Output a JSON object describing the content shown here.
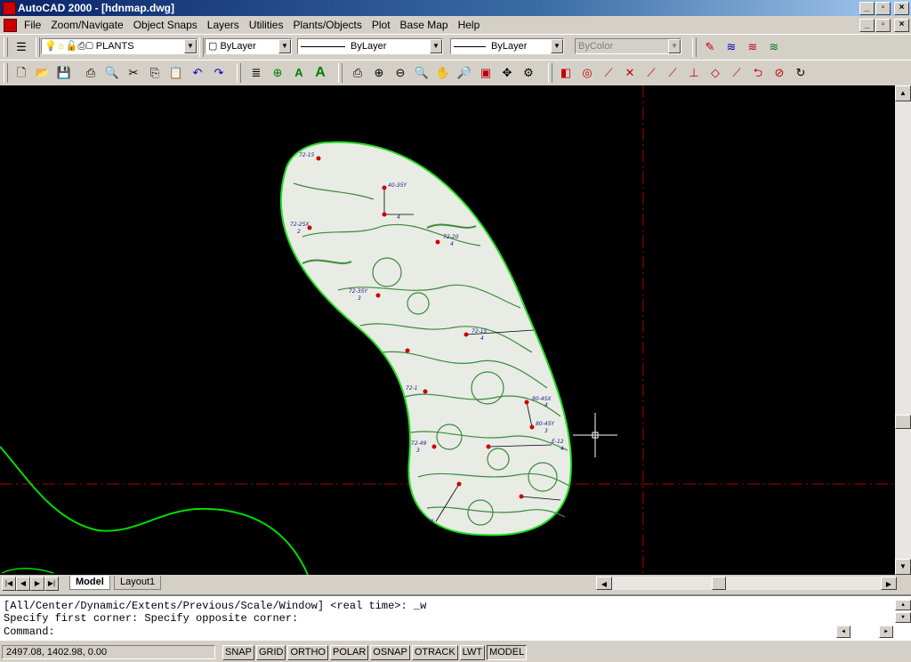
{
  "window": {
    "title": "AutoCAD 2000 - [hdnmap.dwg]",
    "buttons": [
      "_",
      "▫",
      "×"
    ]
  },
  "menubar": {
    "items": [
      "File",
      "Zoom/Navigate",
      "Object Snaps",
      "Layers",
      "Utilities",
      "Plants/Objects",
      "Plot",
      "Base Map",
      "Help"
    ]
  },
  "properties": {
    "layer": "PLANTS",
    "color": "ByLayer",
    "linetype": "ByLayer",
    "lineweight": "ByLayer",
    "plotstyle": "ByColor"
  },
  "map": {
    "labels": [
      "72-15",
      "40-35Y",
      "4",
      "72-25X",
      "2",
      "72-20",
      "4",
      "72-35Y",
      "3",
      "72-15",
      "4",
      "80-45X",
      "4",
      "80-45Y",
      "3",
      "72-49",
      "3",
      "72-1",
      "E-12",
      "4",
      "56"
    ],
    "colors": {
      "background": "#000000",
      "outline": "#00dd00",
      "points": "#cc0000",
      "crosshair": "#ffffff",
      "guide": "#aa0000"
    }
  },
  "tabs": {
    "model": "Model",
    "layout1": "Layout1"
  },
  "command": {
    "line1": "[All/Center/Dynamic/Extents/Previous/Scale/Window] <real time>: _w",
    "line2": "Specify first corner: Specify opposite corner:",
    "prompt": "Command:"
  },
  "status": {
    "coords": "2497.08, 1402.98, 0.00",
    "buttons": [
      "SNAP",
      "GRID",
      "ORTHO",
      "POLAR",
      "OSNAP",
      "OTRACK",
      "LWT",
      "MODEL"
    ]
  }
}
